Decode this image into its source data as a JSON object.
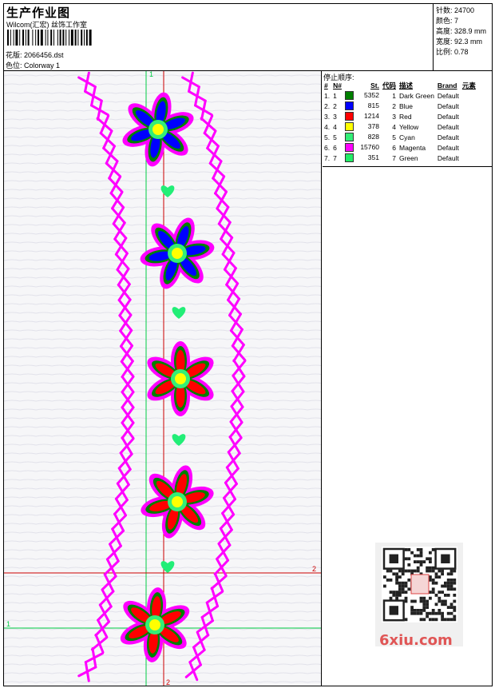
{
  "header": {
    "title": "生产作业图",
    "studio": "Wilcom(汇宏) 丝饰工作室",
    "design_file": "花版: 2066456.dst",
    "colorway": "色位: Colorway 1"
  },
  "stats": {
    "stitches": "针数: 24700",
    "colors": "颜色: 7",
    "height": "高度: 328.9 mm",
    "width": "宽度: 92.3 mm",
    "scale": "比例: 0.78"
  },
  "stop_sequence": {
    "title": "停止顺序:",
    "headers": [
      "#",
      "N#",
      "St.",
      "代码",
      "描述",
      "Brand",
      "元素"
    ],
    "rows": [
      {
        "idx": "1.",
        "n": "1",
        "color": "#008000",
        "st": "5352",
        "code": "1",
        "desc": "Dark Green",
        "brand": "Default"
      },
      {
        "idx": "2.",
        "n": "2",
        "color": "#0000ff",
        "st": "815",
        "code": "2",
        "desc": "Blue",
        "brand": "Default"
      },
      {
        "idx": "3.",
        "n": "3",
        "color": "#ff0000",
        "st": "1214",
        "code": "3",
        "desc": "Red",
        "brand": "Default"
      },
      {
        "idx": "4.",
        "n": "4",
        "color": "#ffff00",
        "st": "378",
        "code": "4",
        "desc": "Yellow",
        "brand": "Default"
      },
      {
        "idx": "5.",
        "n": "5",
        "color": "#33ee77",
        "st": "828",
        "code": "5",
        "desc": "Cyan",
        "brand": "Default"
      },
      {
        "idx": "6.",
        "n": "6",
        "color": "#ff00ff",
        "st": "15760",
        "code": "6",
        "desc": "Magenta",
        "brand": "Default"
      },
      {
        "idx": "7.",
        "n": "7",
        "color": "#22ee66",
        "st": "351",
        "code": "7",
        "desc": "Green",
        "brand": "Default"
      }
    ]
  },
  "canvas": {
    "guide_labels": {
      "v1_top": "1",
      "h1_left": "1",
      "h2_right": "2",
      "v2_bottom": "2"
    },
    "guide_colors": {
      "green": "#00cc44",
      "red": "#cc0000"
    }
  },
  "watermark": "6xiu.com"
}
